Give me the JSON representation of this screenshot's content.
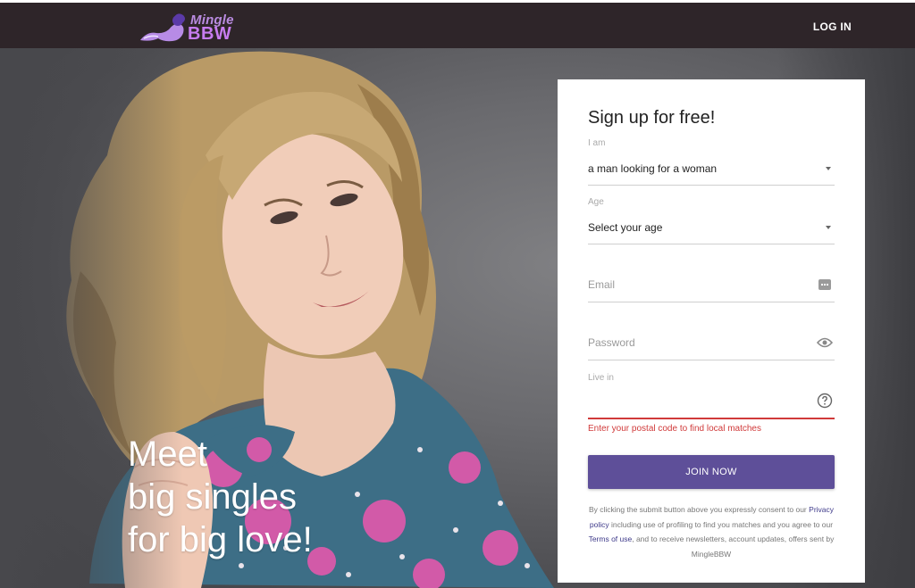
{
  "header": {
    "logo_top": "Mingle",
    "logo_bottom": "BBW",
    "login_label": "LOG IN"
  },
  "hero": {
    "tagline_line1": "Meet",
    "tagline_line2": "big singles",
    "tagline_line3": "for big love!"
  },
  "signup": {
    "title": "Sign up for free!",
    "i_am_label": "I am",
    "i_am_value": "a man looking for a woman",
    "age_label": "Age",
    "age_value": "Select your age",
    "email_placeholder": "Email",
    "password_placeholder": "Password",
    "live_in_label": "Live in",
    "live_in_error": "Enter your postal code to find local matches",
    "join_label": "JOIN NOW",
    "consent_part1": "By clicking the submit button above you expressly consent to our",
    "privacy_link": "Privacy policy",
    "consent_part2": "including use of profiling to find you matches and you agree to our",
    "terms_link": "Terms of use",
    "consent_part3": ", and to receive newsletters, account updates, offers sent by MingleBBW"
  },
  "colors": {
    "header_bg": "#2e2529",
    "button": "#5e4f99",
    "error": "#d03a3a",
    "link": "#3e3a8a"
  },
  "icons": {
    "email_field_icon": "keyboard-icon",
    "password_field_icon": "eye-icon",
    "live_in_field_icon": "question-circle-icon"
  }
}
